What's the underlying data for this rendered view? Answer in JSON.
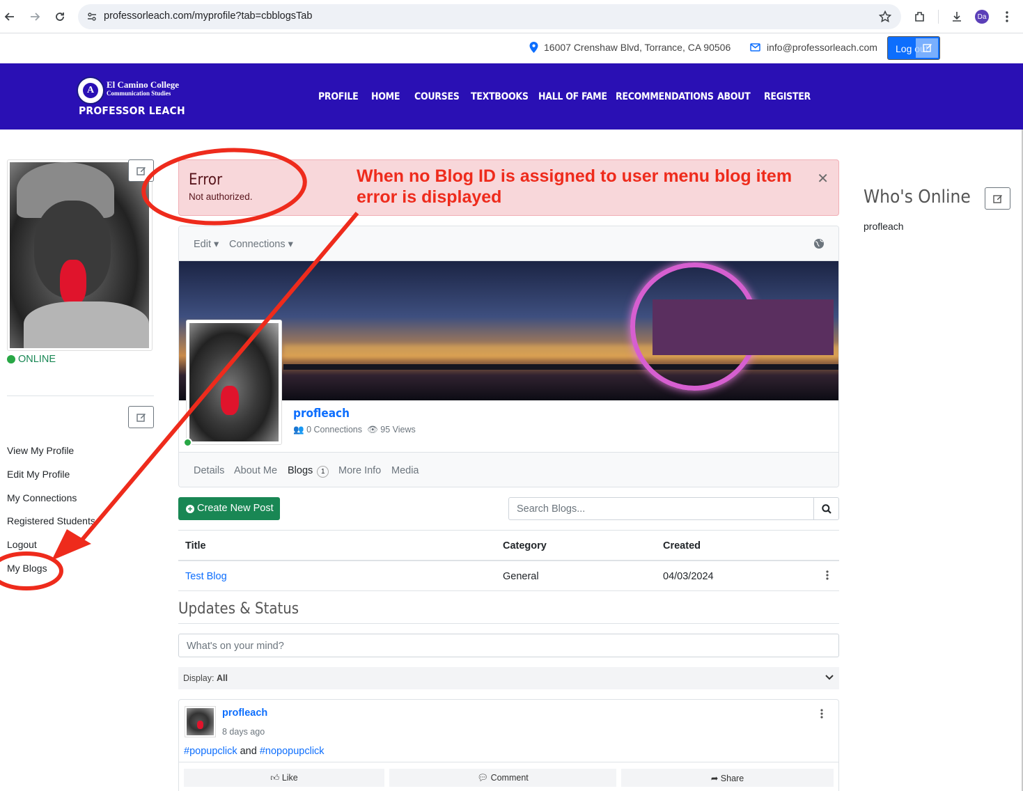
{
  "browser": {
    "url": "professorleach.com/myprofile?tab=cbblogsTab",
    "profile_initials": "Da"
  },
  "topbar": {
    "address": "16007 Crenshaw Blvd, Torrance, CA 90506",
    "email": "info@professorleach.com",
    "logout_label": "Log out"
  },
  "logo": {
    "college": "El Camino College",
    "department": "Communication Studies",
    "name": "PROFESSOR LEACH",
    "seal_letter": "A"
  },
  "nav": {
    "items": [
      "PROFILE",
      "HOME",
      "COURSES",
      "TEXTBOOKS",
      "HALL OF FAME",
      "RECOMMENDATIONS",
      "ABOUT",
      "REGISTER"
    ]
  },
  "sidebar": {
    "status": "ONLINE",
    "links": [
      "View My Profile",
      "Edit My Profile",
      "My Connections",
      "Registered Students",
      "Logout",
      "My Blogs"
    ]
  },
  "alert": {
    "title": "Error",
    "message": "Not authorized.",
    "close_glyph": "✕"
  },
  "annotation": {
    "line1": "When no Blog ID is assigned to user menu blog item",
    "line2": "error is displayed",
    "color": "#ee2b1c"
  },
  "profile": {
    "menu_edit": "Edit",
    "menu_connections": "Connections",
    "username": "profleach",
    "connections": "0 Connections",
    "views": "95 Views",
    "tabs": [
      "Details",
      "About Me",
      "Blogs",
      "More Info",
      "Media"
    ],
    "blogs_count": "1"
  },
  "blogs": {
    "create_label": "Create New Post",
    "search_placeholder": "Search Blogs...",
    "columns": [
      "Title",
      "Category",
      "Created"
    ],
    "rows": [
      {
        "title": "Test Blog",
        "category": "General",
        "created": "04/03/2024"
      }
    ]
  },
  "updates": {
    "title": "Updates & Status",
    "input_placeholder": "What's on your mind?",
    "display_label": "Display:",
    "display_value": "All",
    "post": {
      "author": "profleach",
      "time": "8 days ago",
      "tag1": "#popupclick",
      "joiner": " and ",
      "tag2": "#nopopupclick",
      "like": "Like",
      "comment": "Comment",
      "share": "Share"
    }
  },
  "whos_online": {
    "title": "Who's Online",
    "users": [
      "profleach"
    ]
  },
  "colors": {
    "header_bg": "#2a10b4",
    "alert_bg": "#f8d7da",
    "primary": "#0d6efd",
    "success": "#198754",
    "online": "#28a745"
  }
}
